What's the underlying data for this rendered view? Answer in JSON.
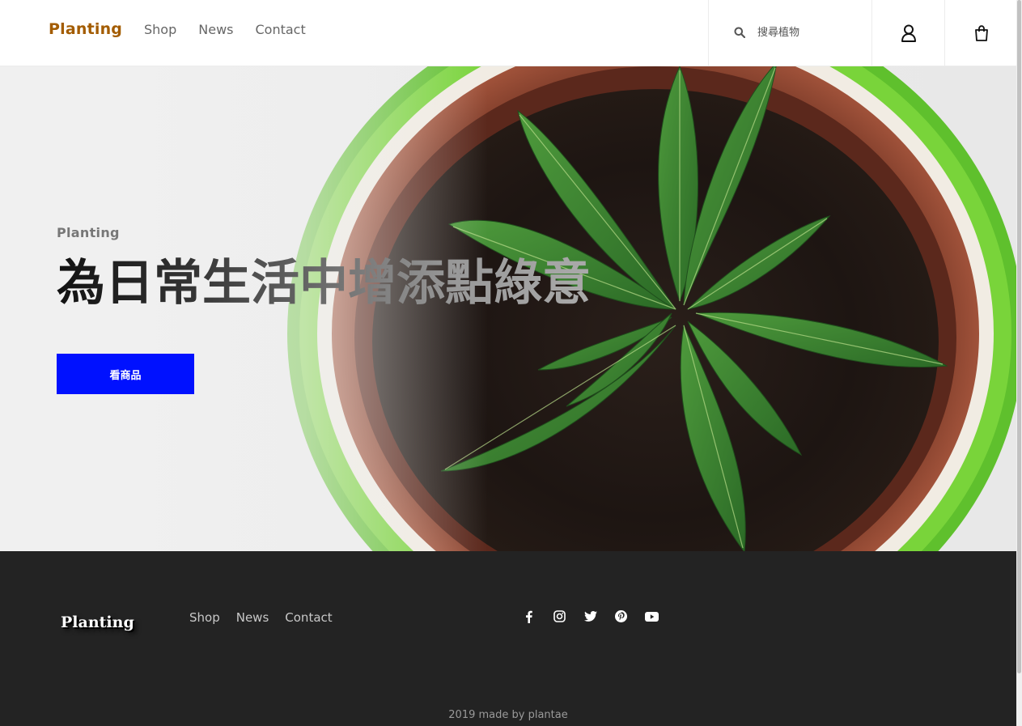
{
  "brand": {
    "name": "Planting",
    "color": "#a35c00"
  },
  "nav": [
    {
      "label": "Shop"
    },
    {
      "label": "News"
    },
    {
      "label": "Contact"
    }
  ],
  "search": {
    "placeholder": "搜尋植物",
    "icon": "search-icon"
  },
  "header_icons": {
    "user": "user-icon",
    "cart": "shopping-bag-icon"
  },
  "hero": {
    "eyebrow": "Planting",
    "headline": "為日常生活中增添點綠意",
    "cta_label": "看商品",
    "cta_color": "#0011ff"
  },
  "footer": {
    "logo": "Planting",
    "nav": [
      {
        "label": "Shop"
      },
      {
        "label": "News"
      },
      {
        "label": "Contact"
      }
    ],
    "social": [
      "facebook-icon",
      "instagram-icon",
      "twitter-icon",
      "pinterest-icon",
      "youtube-icon"
    ],
    "copyright": "2019 made by plantae",
    "background": "#232323"
  }
}
